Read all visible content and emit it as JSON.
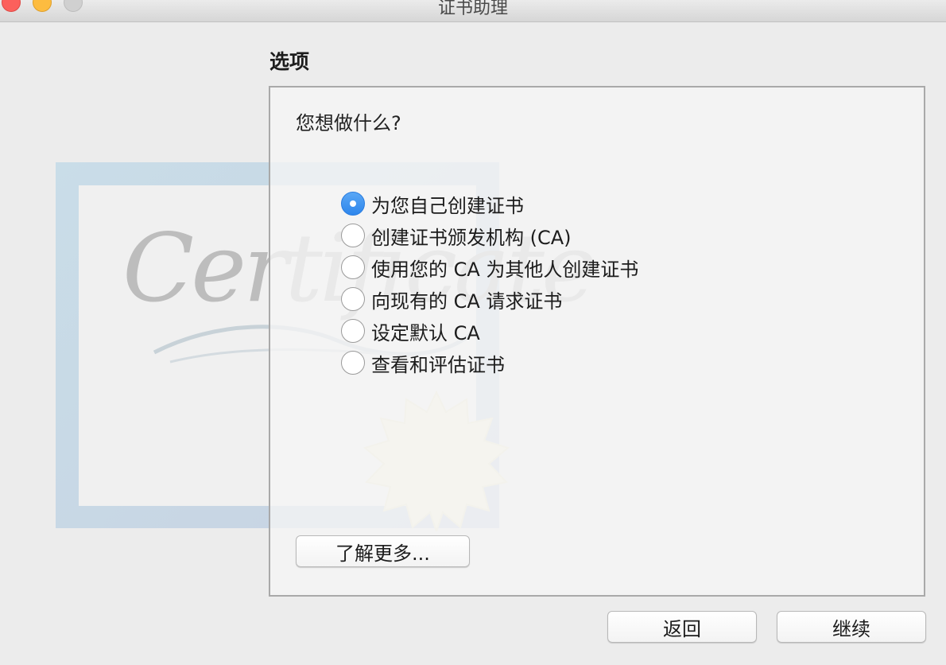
{
  "window": {
    "title": "证书助理"
  },
  "page": {
    "section_title": "选项",
    "question": "您想做什么?"
  },
  "options": [
    {
      "label": "为您自己创建证书",
      "selected": true
    },
    {
      "label": "创建证书颁发机构 (CA)",
      "selected": false
    },
    {
      "label": "使用您的 CA 为其他人创建证书",
      "selected": false
    },
    {
      "label": "向现有的 CA 请求证书",
      "selected": false
    },
    {
      "label": "设定默认 CA",
      "selected": false
    },
    {
      "label": "查看和评估证书",
      "selected": false
    }
  ],
  "buttons": {
    "learn_more": "了解更多...",
    "back": "返回",
    "continue": "继续"
  },
  "background_art": {
    "watermark_text": "Certificate"
  },
  "colors": {
    "accent": "#2e86ec",
    "close": "#fc605c",
    "minimize": "#fdbc40"
  }
}
